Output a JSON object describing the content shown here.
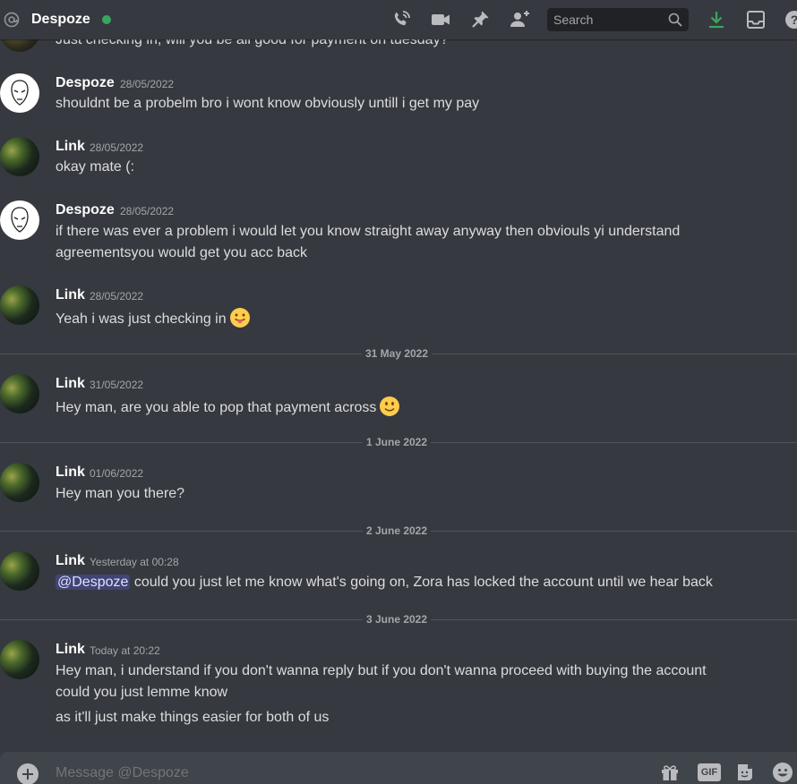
{
  "header": {
    "dm_name": "Despoze",
    "status": "online",
    "search_placeholder": "Search",
    "icons": [
      "at-icon",
      "voice-call-icon",
      "video-call-icon",
      "pin-icon",
      "add-friend-icon",
      "search-icon",
      "download-icon",
      "inbox-icon",
      "help-icon"
    ]
  },
  "clipped_top_text": "Just checking in, will you be all good for payment on tuesday?",
  "messages": [
    {
      "author": "Despoze",
      "timestamp": "28/05/2022",
      "lines": [
        "shouldnt be a probelm bro i wont know obviously untill i get my pay"
      ]
    },
    {
      "author": "Link",
      "timestamp": "28/05/2022",
      "lines": [
        "okay mate (:"
      ]
    },
    {
      "author": "Despoze",
      "timestamp": "28/05/2022",
      "lines": [
        "if there was ever a problem i would let you know straight away anyway then obviouls yi understand",
        "agreementsyou would get you acc back"
      ]
    },
    {
      "author": "Link",
      "timestamp": "28/05/2022",
      "lines": [
        "Yeah i was just checking in"
      ],
      "emoji": "tongue-out-emoji"
    },
    {
      "author": "Link",
      "timestamp": "31/05/2022",
      "lines": [
        "Hey man, are you able to pop that payment across"
      ],
      "emoji": "slight-smile-emoji"
    },
    {
      "author": "Link",
      "timestamp": "01/06/2022",
      "lines": [
        "Hey man you there?"
      ]
    },
    {
      "author": "Link",
      "timestamp": "Yesterday at 00:28",
      "mention": "@Despoze",
      "lines": [
        " could you just let me know what's going on, Zora has locked the account until we hear back"
      ]
    },
    {
      "author": "Link",
      "timestamp": "Today at 20:22",
      "lines": [
        "Hey man, i understand if you don't wanna reply but if you don't wanna proceed with buying the account",
        "could you just lemme know",
        "as it'll just make things easier for both of us"
      ]
    }
  ],
  "dividers": [
    "31 May 2022",
    "1 June 2022",
    "2 June 2022",
    "3 June 2022"
  ],
  "composer": {
    "placeholder": "Message @Despoze",
    "gif_label": "GIF",
    "icons": [
      "add-attachment-icon",
      "gift-icon",
      "gif-icon",
      "sticker-icon",
      "emoji-picker-icon"
    ]
  },
  "colors": {
    "background": "#36393f",
    "header_text": "#ffffff",
    "status_online": "#3ba55d",
    "download_icon": "#3ba55d",
    "mention_bg": "#414675"
  }
}
